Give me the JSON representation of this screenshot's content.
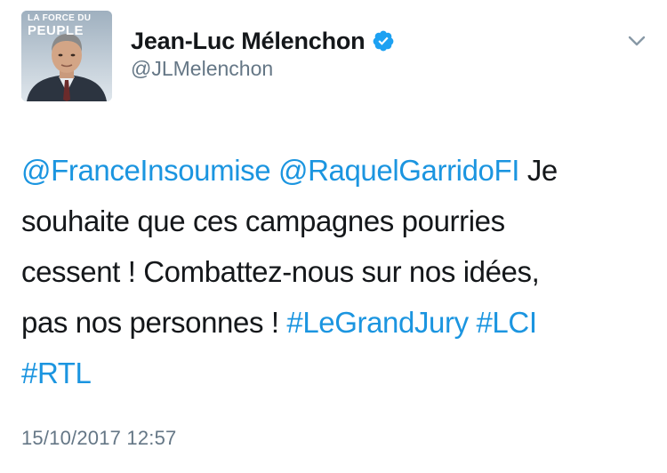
{
  "avatar": {
    "brand_line1": "LA FORCE DU",
    "brand_line2": "PEUPLE"
  },
  "author": {
    "display_name": "Jean-Luc Mélenchon",
    "handle": "@JLMelenchon",
    "verified": true
  },
  "tweet": {
    "lines": [
      [
        {
          "text": "@FranceInsoumise",
          "kind": "mention"
        },
        {
          "text": " ",
          "kind": "text"
        },
        {
          "text": "@RaquelGarridoFI",
          "kind": "mention"
        },
        {
          "text": " Je",
          "kind": "text"
        }
      ],
      [
        {
          "text": "souhaite que ces campagnes pourries",
          "kind": "text"
        }
      ],
      [
        {
          "text": "cessent ! Combattez-nous sur nos idées,",
          "kind": "text"
        }
      ],
      [
        {
          "text": "pas nos personnes ! ",
          "kind": "text"
        },
        {
          "text": "#LeGrandJury",
          "kind": "hashtag"
        },
        {
          "text": " ",
          "kind": "text"
        },
        {
          "text": "#LCI",
          "kind": "hashtag"
        }
      ],
      [
        {
          "text": "#RTL",
          "kind": "hashtag"
        }
      ]
    ],
    "timestamp": "15/10/2017 12:57"
  },
  "icons": {
    "verified": "verified-badge-icon",
    "menu": "chevron-down-icon"
  },
  "colors": {
    "link": "#1b95e0",
    "verified": "#1da1f2",
    "text": "#14171a",
    "secondary": "#657786"
  }
}
